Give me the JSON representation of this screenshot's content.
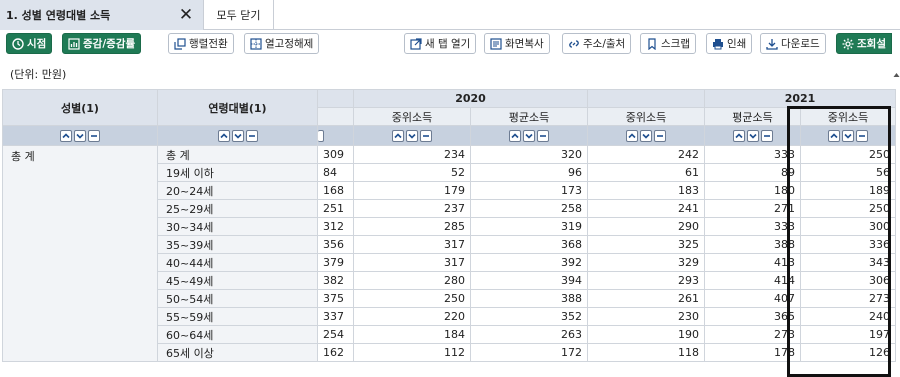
{
  "tabs": {
    "active_label": "1. 성별 연령대별 소득",
    "close_glyph": "✕",
    "close_all_label": "모두 닫기"
  },
  "toolbar": {
    "time_label": "시점",
    "change_label": "증감/증감률",
    "pivot_label": "행렬전환",
    "unfix_label": "열고정해제",
    "newtab_label": "새 탭 열기",
    "copy_label": "화면복사",
    "address_label": "주소/출처",
    "scrap_label": "스크랩",
    "print_label": "인쇄",
    "download_label": "다운로드",
    "settings_label": "조회설"
  },
  "unit_label": "(단위: 만원)",
  "table": {
    "header_gender": "성별(1)",
    "header_age": "연령대별(1)",
    "year_2020": "2020",
    "year_2021": "2021",
    "sub_cols": [
      "중위소득",
      "평균소득",
      "중위소득",
      "평균소득",
      "중위소득"
    ],
    "gender_value": "총 계",
    "rows": [
      {
        "age": "총 계",
        "c0": "309",
        "c1": "234",
        "c2": "320",
        "c3": "242",
        "c4": "333",
        "c5": "250"
      },
      {
        "age": "19세 이하",
        "c0": "84",
        "c1": "52",
        "c2": "96",
        "c3": "61",
        "c4": "89",
        "c5": "56"
      },
      {
        "age": "20~24세",
        "c0": "168",
        "c1": "179",
        "c2": "173",
        "c3": "183",
        "c4": "180",
        "c5": "189"
      },
      {
        "age": "25~29세",
        "c0": "251",
        "c1": "237",
        "c2": "258",
        "c3": "241",
        "c4": "271",
        "c5": "250"
      },
      {
        "age": "30~34세",
        "c0": "312",
        "c1": "285",
        "c2": "319",
        "c3": "290",
        "c4": "333",
        "c5": "300"
      },
      {
        "age": "35~39세",
        "c0": "356",
        "c1": "317",
        "c2": "368",
        "c3": "325",
        "c4": "388",
        "c5": "336"
      },
      {
        "age": "40~44세",
        "c0": "379",
        "c1": "317",
        "c2": "392",
        "c3": "329",
        "c4": "413",
        "c5": "343"
      },
      {
        "age": "45~49세",
        "c0": "382",
        "c1": "280",
        "c2": "394",
        "c3": "293",
        "c4": "414",
        "c5": "306"
      },
      {
        "age": "50~54세",
        "c0": "375",
        "c1": "250",
        "c2": "388",
        "c3": "261",
        "c4": "407",
        "c5": "273"
      },
      {
        "age": "55~59세",
        "c0": "337",
        "c1": "220",
        "c2": "352",
        "c3": "230",
        "c4": "365",
        "c5": "240"
      },
      {
        "age": "60~64세",
        "c0": "254",
        "c1": "184",
        "c2": "263",
        "c3": "190",
        "c4": "273",
        "c5": "197"
      },
      {
        "age": "65세 이상",
        "c0": "162",
        "c1": "112",
        "c2": "172",
        "c3": "118",
        "c4": "178",
        "c5": "126"
      }
    ]
  },
  "colors": {
    "accent_green": "#1f7a55",
    "header_bg": "#dde3ec"
  }
}
